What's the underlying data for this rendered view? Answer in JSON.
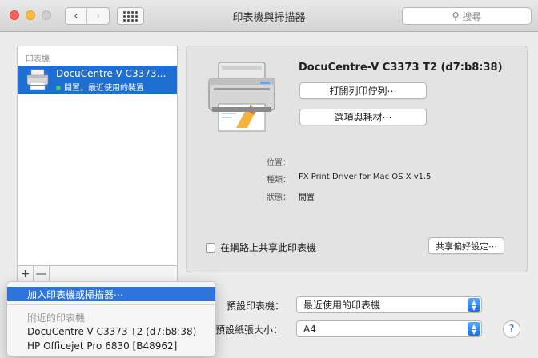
{
  "window": {
    "title": "印表機與掃描器",
    "search_placeholder": "搜尋"
  },
  "nav": {
    "back": "‹",
    "forward": "›"
  },
  "sidebar": {
    "header": "印表機",
    "printers": [
      {
        "name": "DocuCentre-V C3373…",
        "status": "閒置，最近使用的裝置",
        "status_color": "#37d157"
      }
    ],
    "add_label": "+",
    "remove_label": "—"
  },
  "detail": {
    "title": "DocuCentre-V C3373 T2 (d7:b8:38)",
    "queue_button": "打開列印佇列⋯",
    "supplies_button": "選項與耗材⋯",
    "info": [
      {
        "label": "位置：",
        "value": ""
      },
      {
        "label": "種類：",
        "value": "FX Print Driver for Mac OS X v1.5"
      },
      {
        "label": "狀態：",
        "value": "閒置"
      }
    ],
    "share_label": "在網路上共享此印表機",
    "share_checked": false,
    "share_prefs_button": "共享偏好設定⋯"
  },
  "defaults": {
    "printer_label": "預設印表機：",
    "printer_value": "最近使用的印表機",
    "paper_label": "預設紙張大小：",
    "paper_value": "A4"
  },
  "help_label": "?",
  "menu": {
    "add": "加入印表機或掃描器⋯",
    "nearby_header": "附近的印表機",
    "nearby": [
      "DocuCentre-V C3373 T2 (d7:b8:38)",
      "HP Officejet Pro 6830 [B48962]"
    ]
  },
  "colors": {
    "accent": "#1f6fd3",
    "menu_highlight": "#2d75dd"
  }
}
